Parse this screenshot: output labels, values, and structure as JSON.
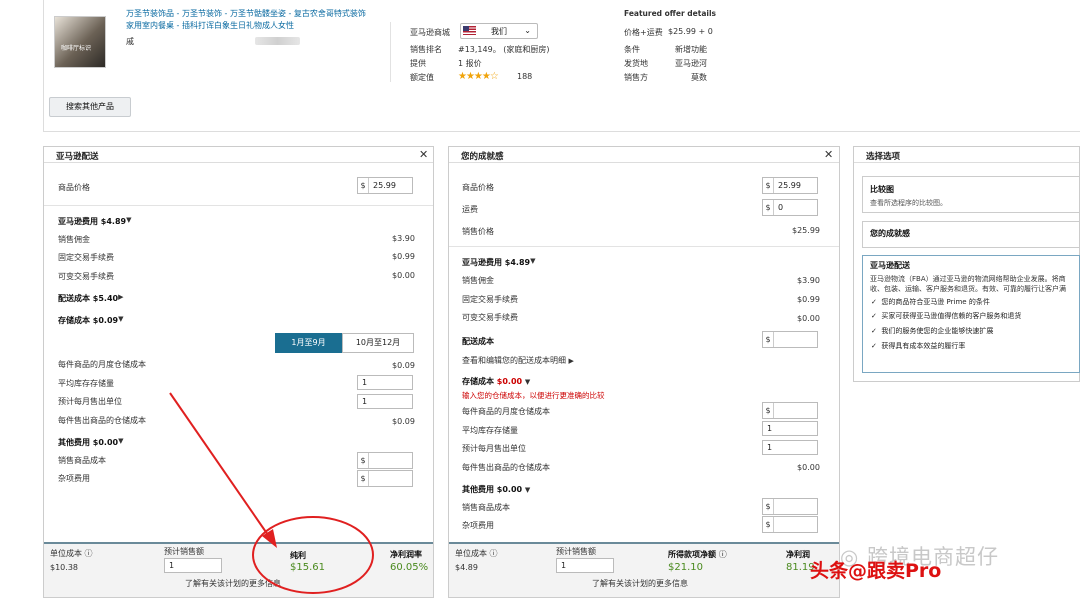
{
  "product": {
    "title_line1": "万圣节装饰品 - 万圣节装饰 - 万圣节骷髅坐姿 - 复古农舍哥特式装饰",
    "title_line2": "家用室内餐桌 - 插科打诨白象生日礼物成人女性",
    "brand_prefix": "戚",
    "thumb_caption": "咖啡厅标识",
    "search_other_label": "搜索其他产品"
  },
  "meta": {
    "marketplace_label": "亚马逊商城",
    "marketplace_value": "我们",
    "rank_label": "销售排名",
    "rank_value": "#13,149。 (家庭和厨房)",
    "offers_label": "提供",
    "offers_value": "1 报价",
    "rating_label": "额定值",
    "stars": "★★★★☆",
    "rating_count": "188"
  },
  "offer": {
    "title": "Featured offer details",
    "price_label": "价格+运费",
    "price_value": "$25.99 + 0",
    "condition_label": "条件",
    "condition_value": "新增功能",
    "ship_label": "发货地",
    "ship_value": "亚马逊河",
    "seller_label": "销售方",
    "seller_value": "莫数"
  },
  "fba": {
    "title": "亚马逊配送",
    "item_price_label": "商品价格",
    "item_price": "25.99",
    "amazon_fees_label": "亚马逊费用",
    "amazon_fees": "$4.89",
    "referral_label": "销售佣金",
    "referral": "$3.90",
    "fixed_label": "固定交易手续费",
    "fixed": "$0.99",
    "variable_label": "可变交易手续费",
    "variable": "$0.00",
    "ship_cost_label": "配送成本",
    "ship_cost": "$5.40",
    "storage_label": "存储成本",
    "storage": "$0.09",
    "tab1": "1月至9月",
    "tab2": "10月至12月",
    "monthly_label": "每件商品的月度仓储成本",
    "monthly": "$0.09",
    "avg_inv_label": "平均库存存储量",
    "avg_inv": "1",
    "est_units_label": "预计每月售出单位",
    "est_units": "1",
    "per_unit_label": "每件售出商品的仓储成本",
    "per_unit": "$0.09",
    "other_label": "其他费用",
    "other": "$0.00",
    "cogs_label": "销售商品成本",
    "misc_label": "杂项费用",
    "unit_cost_label": "单位成本",
    "unit_cost": "$10.38",
    "est_sales_label": "预计销售额",
    "est_sales": "1",
    "net_label": "纯利",
    "net": "$15.61",
    "margin_label": "净利润率",
    "margin": "60.05%",
    "learn_more": "了解有关该计划的更多信息"
  },
  "self": {
    "title": "您的成就感",
    "item_price_label": "商品价格",
    "item_price": "25.99",
    "shipping_label": "运费",
    "shipping": "0",
    "sale_price_label": "销售价格",
    "sale_price": "$25.99",
    "amazon_fees_label": "亚马逊费用",
    "amazon_fees": "$4.89",
    "referral_label": "销售佣金",
    "referral": "$3.90",
    "fixed_label": "固定交易手续费",
    "fixed": "$0.99",
    "variable_label": "可变交易手续费",
    "variable": "$0.00",
    "ship_cost_label": "配送成本",
    "ship_link": "查看和编辑您的配送成本明细",
    "storage_label": "存储成本",
    "storage": "$0.00",
    "storage_hint": "输入您的仓储成本，以便进行更准确的比较",
    "monthly_label": "每件商品的月度仓储成本",
    "avg_inv_label": "平均库存存储量",
    "avg_inv": "1",
    "est_units_label": "预计每月售出单位",
    "est_units": "1",
    "per_unit_label": "每件售出商品的仓储成本",
    "per_unit": "$0.00",
    "other_label": "其他费用",
    "other": "$0.00",
    "cogs_label": "销售商品成本",
    "misc_label": "杂项费用",
    "unit_cost_label": "单位成本",
    "unit_cost": "$4.89",
    "est_sales_label": "预计销售额",
    "est_sales": "1",
    "proceeds_label": "所得款项净额",
    "proceeds": "$21.10",
    "margin_label": "净利润",
    "margin": "81.19",
    "learn_more": "了解有关该计划的更多信息"
  },
  "options": {
    "title": "选择选项",
    "compare_title": "比较图",
    "compare_desc": "查看所选程序的比较图。",
    "yours_title": "您的成就感",
    "fba_title": "亚马逊配送",
    "fba_desc1": "亚马逊物流（FBA）通过亚马逊的物流网络帮助企业发展。将商",
    "fba_desc2": "收、包装、运输、客户服务和退货。有效、可靠的履行让客户满",
    "check1": "您的商品符合亚马逊 Prime 的条件",
    "check2": "买家可获得亚马逊值得信赖的客户服务和退货",
    "check3": "我们的服务使您的企业能够快速扩展",
    "check4": "获得具有成本效益的履行率"
  },
  "watermark": {
    "wechat": "跨境电商超仔",
    "toutiao": "头条@跟卖Pro"
  },
  "colors": {
    "link": "#0a6aa1",
    "profit_green": "#4a8a1e",
    "tab_active": "#1a6e91",
    "annotation_red": "#e02020"
  }
}
